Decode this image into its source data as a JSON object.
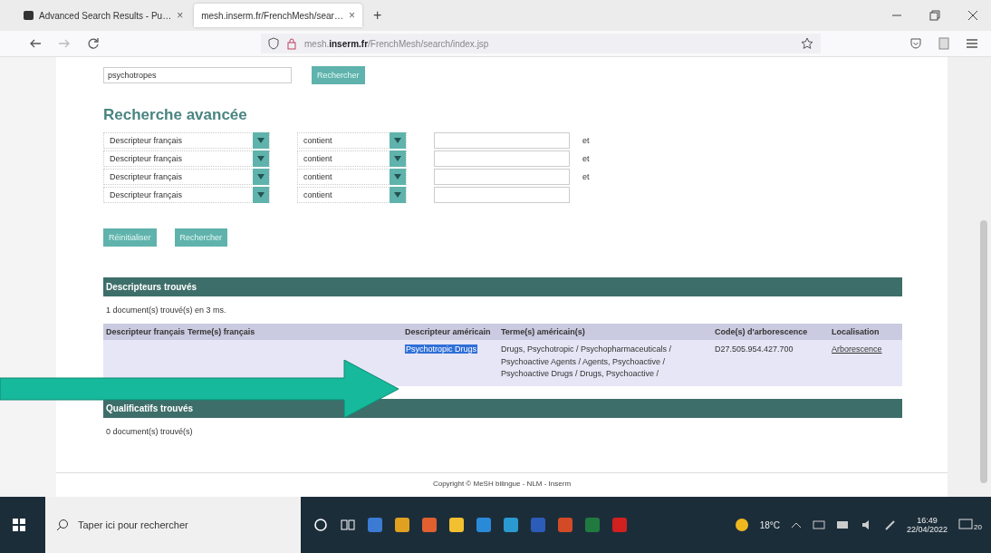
{
  "browser": {
    "tabs": [
      {
        "label": "Advanced Search Results - Pu…",
        "selected": false
      },
      {
        "label": "mesh.inserm.fr/FrenchMesh/sear…",
        "selected": true
      }
    ],
    "tab_close": "×",
    "new_tab": "+",
    "url": {
      "prefix": "mesh.",
      "domain": "inserm.fr",
      "path": "/FrenchMesh/search/index.jsp"
    }
  },
  "quick_search": {
    "value": "psychotropes",
    "button": "Rechercher"
  },
  "advanced": {
    "title": "Recherche avancée",
    "criteria": [
      {
        "field": "Descripteur français",
        "operator": "contient",
        "connector": "et"
      },
      {
        "field": "Descripteur français",
        "operator": "contient",
        "connector": "et"
      },
      {
        "field": "Descripteur français",
        "operator": "contient",
        "connector": "et"
      },
      {
        "field": "Descripteur français",
        "operator": "contient"
      }
    ],
    "buttons": [
      "Réinitialiser",
      "Rechercher"
    ]
  },
  "descriptors": {
    "title": "Descripteurs trouvés",
    "count": "1 document(s) trouvé(s) en 3 ms.",
    "columns": [
      "Descripteur français",
      "Terme(s) français",
      "Descripteur américain",
      "Terme(s) américain(s)",
      "Code(s) d'arborescence",
      "Localisation"
    ],
    "rows": [
      {
        "american_descriptor": "Psychotropic Drugs",
        "american_descriptor_selected": true,
        "american_terms": "Drugs, Psychotropic / Psychopharmaceuticals / Psychoactive Agents / Agents, Psychoactive / Psychoactive Drugs / Drugs, Psychoactive /",
        "tree_code": "D27.505.954.427.700",
        "location": "Arborescence"
      }
    ]
  },
  "qualifiers": {
    "title": "Qualificatifs trouvés",
    "count": "0 document(s) trouvé(s)"
  },
  "footer": "Copyright © MeSH bilingue - NLM - Inserm",
  "taskbar": {
    "search_placeholder": "Taper ici pour rechercher",
    "temperature": "18°C",
    "time": "16:49",
    "date": "22/04/2022",
    "notifications": "20"
  }
}
